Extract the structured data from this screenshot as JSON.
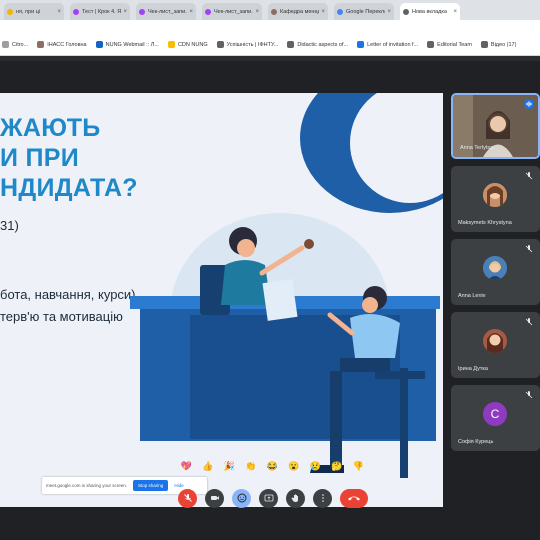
{
  "browser": {
    "tabs": [
      {
        "title": "ня, при ці",
        "color": "#f4b400"
      },
      {
        "title": "Тест | Крок 4. Я...",
        "color": "#a142f4"
      },
      {
        "title": "Чек-лист_запи...",
        "color": "#a142f4"
      },
      {
        "title": "Чек-лист_запи...",
        "color": "#a142f4"
      },
      {
        "title": "Кафедра менедж...",
        "color": "#8d6e63"
      },
      {
        "title": "Google Переклад...",
        "color": "#4285f4"
      },
      {
        "title": "Нова вкладка",
        "color": "#5f6368"
      }
    ],
    "bookmarks": [
      {
        "label": "Citro...",
        "color": "#9e9e9e"
      },
      {
        "label": "ІНАСС Головна",
        "color": "#8d6e63"
      },
      {
        "label": "NUNG Webmail :: Л...",
        "color": "#1565c0"
      },
      {
        "label": "CDN NUNG",
        "color": "#fbbc04"
      },
      {
        "label": "Успішність | ІФНТУ...",
        "color": "#5f6368"
      },
      {
        "label": "Didactic aspects of...",
        "color": "#5f6368"
      },
      {
        "label": "Letter of invitation f...",
        "color": "#1a73e8"
      },
      {
        "label": "Editorial Team",
        "color": "#5f6368"
      },
      {
        "label": "Відео (17)",
        "color": "#5f6368"
      }
    ]
  },
  "slide": {
    "title_lines": [
      "ЖАЮТЬ",
      "И ПРИ",
      "НДИДАТА?"
    ],
    "text_lines": [
      "31)",
      "бота, навчання, курси)",
      "терв'ю та мотивацію"
    ]
  },
  "share_bar": {
    "message": "meet.google.com is sharing your screen.",
    "stop_label": "Stop sharing",
    "hide_label": "Hide"
  },
  "participants": [
    {
      "name": "Anna Terlytsa"
    },
    {
      "name": "Maksymets Khrystyna"
    },
    {
      "name": "Anna Leniv"
    },
    {
      "name": "Ірина Дутка"
    },
    {
      "name": "Софія Курець",
      "initial": "С"
    }
  ],
  "reactions": [
    "💖",
    "👍",
    "🎉",
    "👏",
    "😂",
    "😮",
    "😢",
    "🤔",
    "👎"
  ],
  "colors": {
    "accent": "#1e88c8",
    "end_call": "#ea4335",
    "slide_bg": "#eef2f8",
    "illustration_blue": "#1f5fa8"
  }
}
